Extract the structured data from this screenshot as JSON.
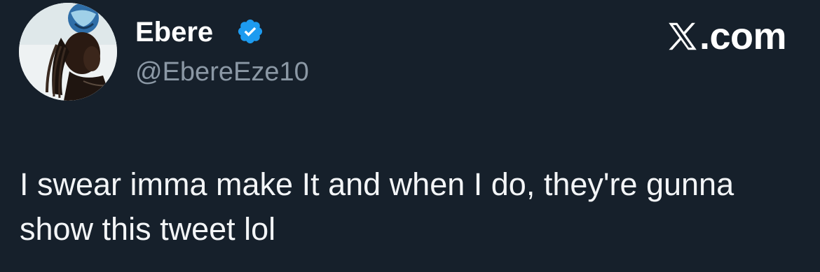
{
  "author": {
    "display_name": "Ebere",
    "handle": "@EbereEze10",
    "verified": true,
    "verified_color": "#1d9bf0",
    "avatar_icon": "profile-photo"
  },
  "brand": {
    "icon": "x-logo-icon",
    "text": ".com"
  },
  "tweet": {
    "text": "I swear imma make It and when I do, they're gunna show this tweet lol"
  },
  "colors": {
    "background": "#16202b",
    "handle": "#8b98a5",
    "text": "#ffffff"
  }
}
